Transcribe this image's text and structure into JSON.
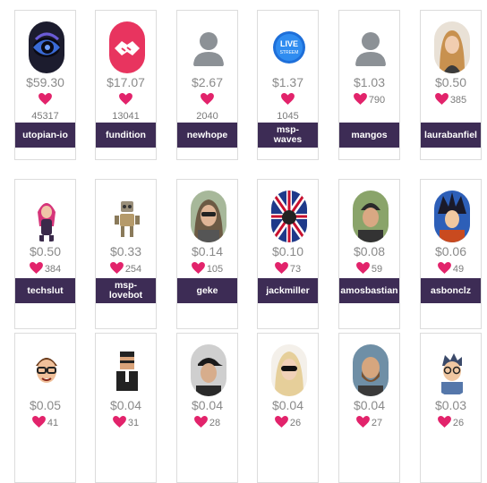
{
  "colors": {
    "heart": "#e2236b",
    "nameplate": "#3d2c55",
    "price": "#8a8a8a"
  },
  "rows": [
    [
      {
        "name": "utopian-io",
        "price": "$59.30",
        "count": "45317",
        "count_below": true,
        "avatar": "utopian-logo-icon"
      },
      {
        "name": "fundition",
        "price": "$17.07",
        "count": "13041",
        "count_below": true,
        "avatar": "handshake-logo-icon"
      },
      {
        "name": "newhope",
        "price": "$2.67",
        "count": "2040",
        "count_below": true,
        "avatar": "default-user-icon"
      },
      {
        "name": "msp-waves",
        "price": "$1.37",
        "count": "1045",
        "count_below": true,
        "avatar": "live-stream-icon"
      },
      {
        "name": "mangos",
        "price": "$1.03",
        "count": "790",
        "count_below": false,
        "avatar": "default-user-icon"
      },
      {
        "name": "laurabanfiel",
        "price": "$0.50",
        "count": "385",
        "count_below": false,
        "avatar": "woman-photo-icon"
      }
    ],
    [
      {
        "name": "techslut",
        "price": "$0.50",
        "count": "384",
        "count_below": false,
        "avatar": "pink-hair-character-icon"
      },
      {
        "name": "msp-lovebot",
        "price": "$0.33",
        "count": "254",
        "count_below": false,
        "avatar": "robot-icon"
      },
      {
        "name": "geke",
        "price": "$0.14",
        "count": "105",
        "count_below": false,
        "avatar": "woman-sunglasses-photo-icon"
      },
      {
        "name": "jackmiller",
        "price": "$0.10",
        "count": "73",
        "count_below": false,
        "avatar": "flag-collage-icon"
      },
      {
        "name": "amosbastian",
        "price": "$0.08",
        "count": "59",
        "count_below": false,
        "avatar": "man-beanie-photo-icon"
      },
      {
        "name": "asbonclz",
        "price": "$0.06",
        "count": "49",
        "count_below": false,
        "avatar": "anime-character-icon"
      }
    ],
    [
      {
        "name": "",
        "price": "$0.05",
        "count": "41",
        "count_below": false,
        "avatar": "cartoon-man-glasses-icon"
      },
      {
        "name": "",
        "price": "$0.04",
        "count": "31",
        "count_below": false,
        "avatar": "pixel-man-suit-icon"
      },
      {
        "name": "",
        "price": "$0.04",
        "count": "28",
        "count_below": false,
        "avatar": "man-cap-photo-icon"
      },
      {
        "name": "",
        "price": "$0.04",
        "count": "26",
        "count_below": false,
        "avatar": "blonde-sunglasses-photo-icon"
      },
      {
        "name": "",
        "price": "$0.04",
        "count": "27",
        "count_below": false,
        "avatar": "bearded-man-photo-icon"
      },
      {
        "name": "",
        "price": "$0.03",
        "count": "26",
        "count_below": false,
        "avatar": "cartoon-glasses-icon"
      }
    ]
  ]
}
